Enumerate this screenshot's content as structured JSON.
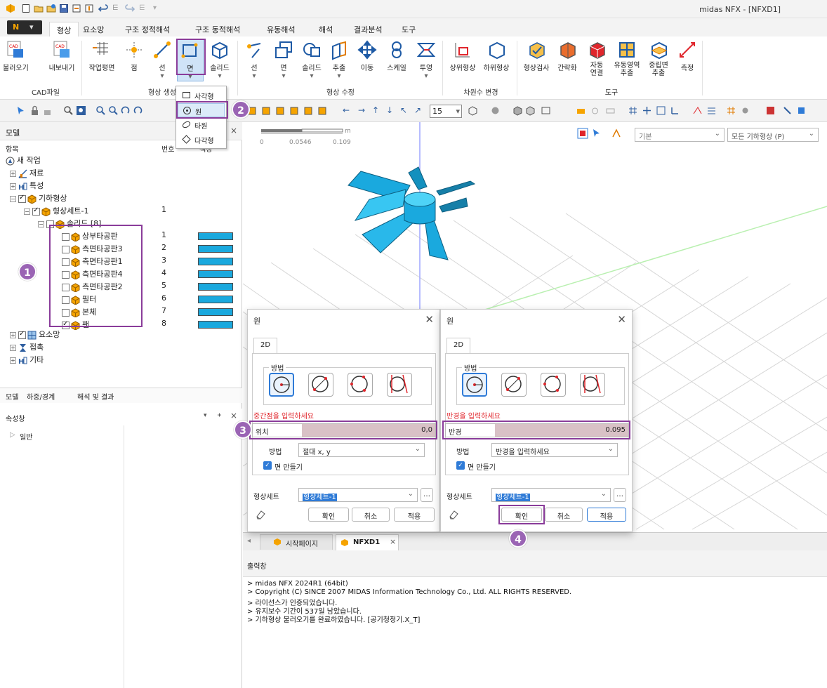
{
  "app": {
    "title": "midas NFX - [NFXD1]"
  },
  "ribbon": {
    "app_menu": "N",
    "tabs": [
      "형상",
      "요소망",
      "구조 정적해석",
      "구조 동적해석",
      "유동해석",
      "해석",
      "결과분석",
      "도구"
    ],
    "buttons": {
      "import": "불러오기",
      "export": "내보내기",
      "workplane": "작업평면",
      "point": "점",
      "line": "선",
      "face": "면",
      "solid": "솔리드",
      "m_line": "선",
      "m_face": "면",
      "m_solid": "솔리드",
      "extrude": "추출",
      "move": "이동",
      "scale": "스케일",
      "project": "투영",
      "upper": "상위형상",
      "lower": "하위형상",
      "check": "형상검사",
      "simplify": "간략화",
      "autoconn": "자동\n연결",
      "flowext": "유동영역\n추출",
      "midext": "중립면\n추출",
      "measure": "측정"
    },
    "groups": [
      "CAD파일",
      "형상 생성",
      "형상 수정",
      "차원수 변경",
      "도구"
    ]
  },
  "shape_dropdown": {
    "items": [
      "사각형",
      "원",
      "타원",
      "다각형"
    ]
  },
  "toolbar": {
    "zoom_value": "15"
  },
  "model_panel": {
    "title": "모델",
    "col_item": "항목",
    "col_num": "번호",
    "col_color": "색상",
    "root": "새 작업",
    "nodes": {
      "material": "재료",
      "property": "특성",
      "geometry": "기하형상",
      "shapeset": "형상세트-1",
      "shapeset_num": "1",
      "solid": "솔리드 [8]",
      "mesh": "요소망",
      "contact": "접촉",
      "other": "기타"
    },
    "solids": [
      {
        "name": "상부타공판",
        "num": "1",
        "checked": false
      },
      {
        "name": "측면타공판3",
        "num": "2",
        "checked": false
      },
      {
        "name": "측면타공판1",
        "num": "3",
        "checked": false
      },
      {
        "name": "측면타공판4",
        "num": "4",
        "checked": false
      },
      {
        "name": "측면타공판2",
        "num": "5",
        "checked": false
      },
      {
        "name": "필터",
        "num": "6",
        "checked": false
      },
      {
        "name": "본체",
        "num": "7",
        "checked": false
      },
      {
        "name": "팬",
        "num": "8",
        "checked": true
      }
    ],
    "bottom_tabs": [
      "모델",
      "하중/경계",
      "해석 및 결과"
    ],
    "prop_title": "속성창",
    "prop_general": "일반"
  },
  "viewport": {
    "scale_unit": "m",
    "scale_ticks": [
      "0",
      "0.0546",
      "0.109"
    ],
    "filter_basic": "기본",
    "filter_all": "모든 기하형상 (P)"
  },
  "dialog_left": {
    "title": "원",
    "tab": "2D",
    "group": "방법",
    "prompt": "중간점을 입력하세요",
    "field_label": "위치",
    "field_value": "0,0",
    "method_label": "방법",
    "method_value": "절대 x, y",
    "make_face": "면 만들기",
    "shapeset_label": "형상세트",
    "shapeset_value": "형상세트-1",
    "ok": "확인",
    "cancel": "취소",
    "apply": "적용"
  },
  "dialog_right": {
    "title": "원",
    "tab": "2D",
    "group": "방법",
    "prompt": "반경을 입력하세요",
    "field_label": "반경",
    "field_value": "0.095",
    "method_label": "방법",
    "method_value": "반경을 입력하세요",
    "make_face": "면 만들기",
    "shapeset_label": "형상세트",
    "shapeset_value": "형상세트-1",
    "ok": "확인",
    "cancel": "취소",
    "apply": "적용"
  },
  "doc_tabs": [
    "시작페이지",
    "NFXD1"
  ],
  "output": {
    "title": "출력창",
    "lines": [
      "> midas NFX 2024R1 (64bit)",
      "> Copyright (C) SINCE 2007 MIDAS Information Technology Co., Ltd. ALL RIGHTS RESERVED.",
      "> 라이선스가 인증되었습니다.",
      "> 유지보수 기간이 537일 남았습니다.",
      "> 기하형상 불러오기를 완료하였습니다. [공기청정기.X_T]"
    ]
  },
  "callouts": [
    "1",
    "2",
    "3",
    "4"
  ],
  "colors": {
    "accent": "#8a3c9a",
    "solid_swatch": "#1aa9de",
    "fan": "#1aa9de",
    "selection": "#2f7bd7",
    "prompt": "#e0262c"
  }
}
